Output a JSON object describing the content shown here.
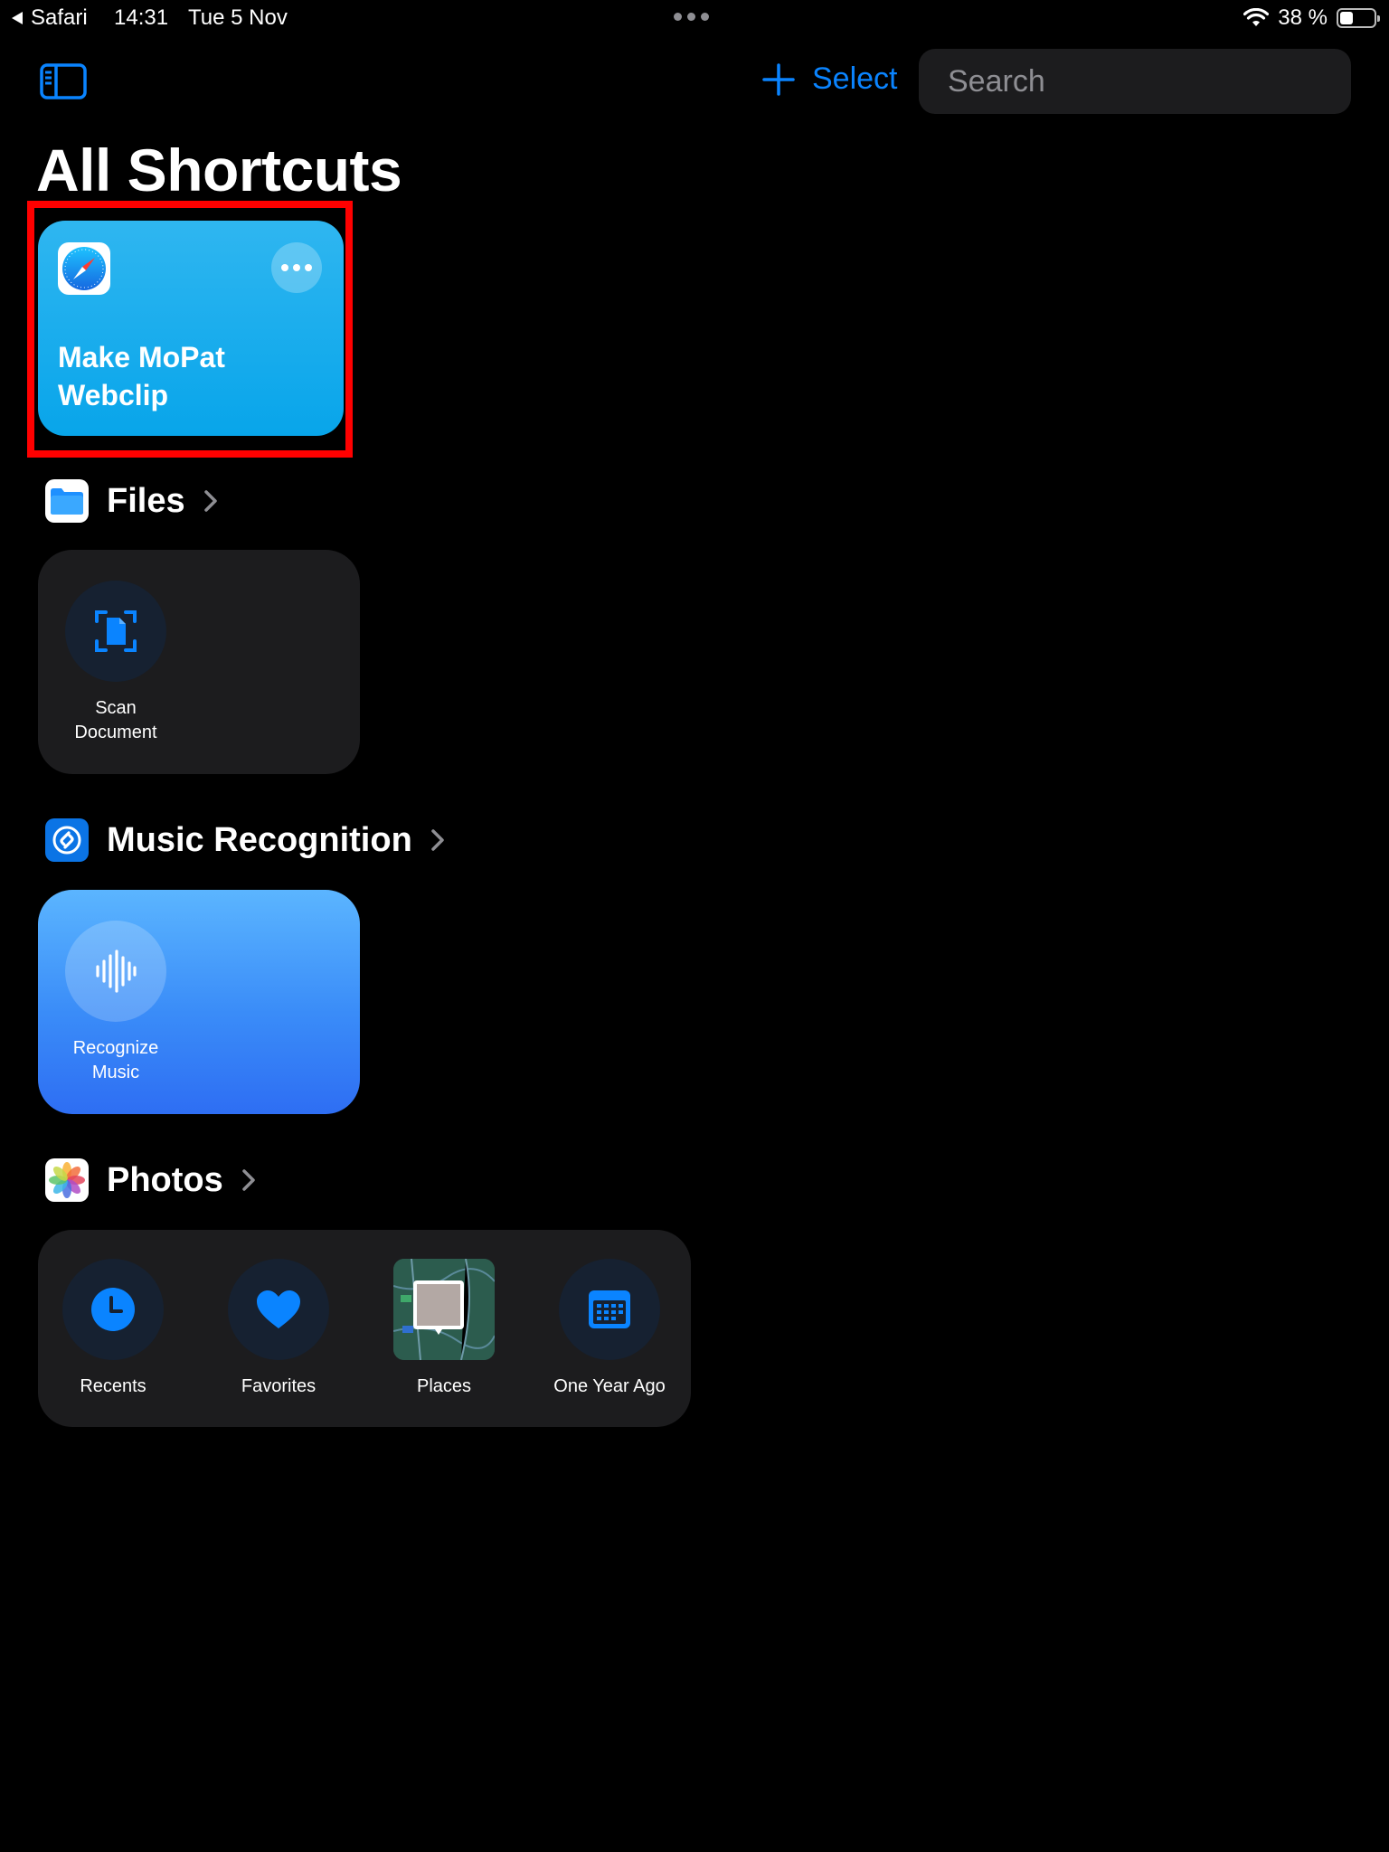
{
  "status_bar": {
    "back_app": "Safari",
    "time": "14:31",
    "date": "Tue 5 Nov",
    "battery": "38 %",
    "battery_level": 0.38
  },
  "toolbar": {
    "sidebar_icon": "sidebar-toggle-icon",
    "add_icon": "plus-icon",
    "select_label": "Select",
    "search_placeholder": "Search",
    "accent_color": "#0a84ff"
  },
  "page": {
    "title": "All Shortcuts"
  },
  "featured_shortcut": {
    "name": "Make MoPat Webclip",
    "app_icon": "safari-icon",
    "color": "#08a5ea"
  },
  "sections": {
    "files": {
      "title": "Files",
      "app_icon": "files-app-icon",
      "items": [
        {
          "label": "Scan Document",
          "icon": "scan-document-icon"
        }
      ]
    },
    "music": {
      "title": "Music Recognition",
      "app_icon": "shazam-icon",
      "items": [
        {
          "label": "Recognize Music",
          "icon": "waveform-icon"
        }
      ]
    },
    "photos": {
      "title": "Photos",
      "app_icon": "photos-app-icon",
      "items": [
        {
          "label": "Recents",
          "icon": "clock-icon"
        },
        {
          "label": "Favorites",
          "icon": "heart-icon"
        },
        {
          "label": "Places",
          "icon": "map-thumbnail"
        },
        {
          "label": "One Year Ago",
          "icon": "calendar-icon"
        }
      ]
    }
  }
}
